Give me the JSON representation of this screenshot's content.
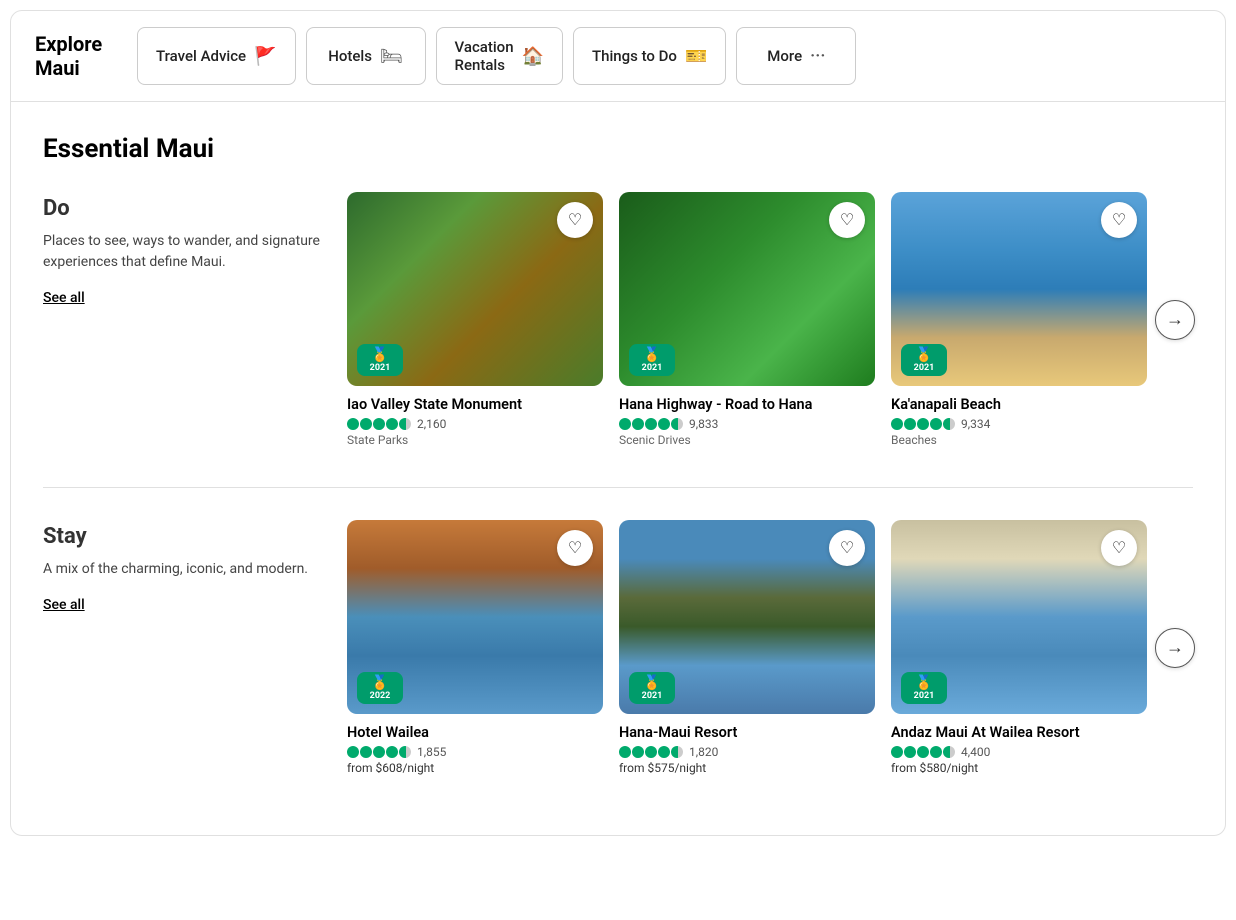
{
  "header": {
    "logo_line1": "Explore",
    "logo_line2": "Maui",
    "tabs": [
      {
        "label": "Travel Advice",
        "icon": "🚩"
      },
      {
        "label": "Hotels",
        "icon": "🛏"
      },
      {
        "label": "Vacation\nRentals",
        "icon": "🏠"
      },
      {
        "label": "Things to Do",
        "icon": "🎫"
      },
      {
        "label": "More",
        "icon": "···"
      }
    ]
  },
  "main_title": "Essential Maui",
  "sections": [
    {
      "id": "do",
      "heading": "Do",
      "description": "Places to see, ways to wander, and signature experiences that define Maui.",
      "see_all": "See all",
      "cards": [
        {
          "name": "Iao Valley State Monument",
          "img_class": "img-iao",
          "rating_filled": 4,
          "rating_half": true,
          "reviews": "2,160",
          "category": "State Parks",
          "award_year": "2021"
        },
        {
          "name": "Hana Highway - Road to Hana",
          "img_class": "img-hana",
          "rating_filled": 4,
          "rating_half": true,
          "reviews": "9,833",
          "category": "Scenic Drives",
          "award_year": "2021"
        },
        {
          "name": "Ka'anapali Beach",
          "img_class": "img-kaanapali",
          "rating_filled": 4,
          "rating_half": true,
          "reviews": "9,334",
          "category": "Beaches",
          "award_year": "2021"
        }
      ]
    },
    {
      "id": "stay",
      "heading": "Stay",
      "description": "A mix of the charming, iconic, and modern.",
      "see_all": "See all",
      "cards": [
        {
          "name": "Hotel Wailea",
          "img_class": "img-hotel-wailea",
          "rating_filled": 4,
          "rating_half": true,
          "reviews": "1,855",
          "category": null,
          "price": "from $608/night",
          "award_year": "2022"
        },
        {
          "name": "Hana-Maui Resort",
          "img_class": "img-hana-maui",
          "rating_filled": 4,
          "rating_half": true,
          "reviews": "1,820",
          "category": null,
          "price": "from $575/night",
          "award_year": "2021"
        },
        {
          "name": "Andaz Maui At Wailea Resort",
          "img_class": "img-andaz",
          "rating_filled": 4,
          "rating_half": true,
          "reviews": "4,400",
          "category": null,
          "price": "from $580/night",
          "award_year": "2021"
        }
      ]
    }
  ],
  "heart_char": "♡",
  "arrow_char": "→"
}
